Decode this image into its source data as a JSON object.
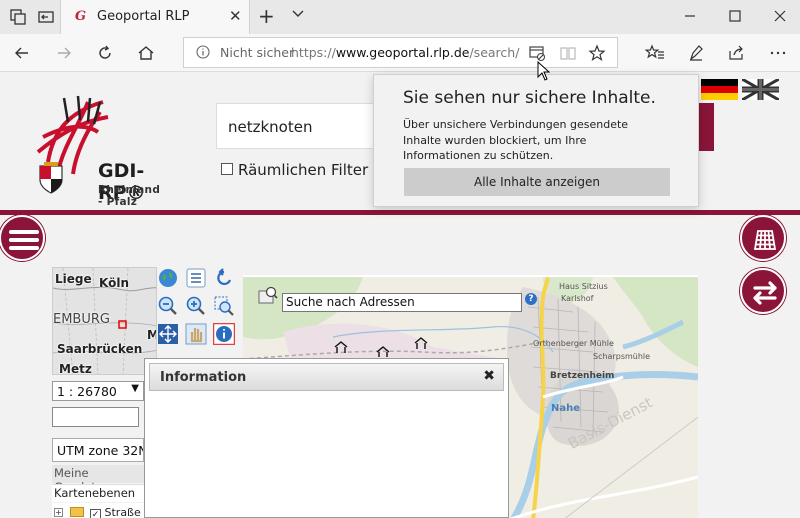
{
  "browser": {
    "tab_title": "Geoportal RLP",
    "tab_favicon_letter": "G",
    "tab_close": "✕",
    "new_tab": "+",
    "insecure_label": "Nicht sicher",
    "url_scheme": "https://",
    "url_host": "www.geoportal.rlp.de",
    "url_path": "/search/",
    "accent_color": "#8a1538"
  },
  "header": {
    "logo_text": "GDI-RP®",
    "logo_subtitle": "Rheinland - Pfalz",
    "search_value": "netzknoten",
    "spatial_filter_label": "Räumlichen Filter be"
  },
  "flyout": {
    "title": "Sie sehen nur sichere Inhalte.",
    "body": "Über unsichere Verbindungen gesendete Inhalte wurden blockiert, um Ihre Informationen zu schützen.",
    "button": "Alle Inhalte anzeigen"
  },
  "minimap": {
    "labels": [
      "Liege",
      "Köln",
      "EMBURG",
      "Saarbrücken",
      "Metz",
      "M"
    ]
  },
  "panel": {
    "scale_value": "1 : 26780",
    "crs_value": "UTM zone 32N",
    "my_geodata": "Meine Geodaten",
    "layers": "Kartenebenen",
    "tree_item": "Straße"
  },
  "map": {
    "address_search_value": "Suche nach Adressen",
    "help": "?",
    "labels": [
      "Haus Sitzius",
      "Karlshof",
      "Orthenberger Mühle",
      "Scharpsmühle",
      "Bretzenheim",
      "Nahe",
      "Basis-Dienst"
    ]
  },
  "info_dialog": {
    "title": "Information",
    "close": "✖"
  }
}
